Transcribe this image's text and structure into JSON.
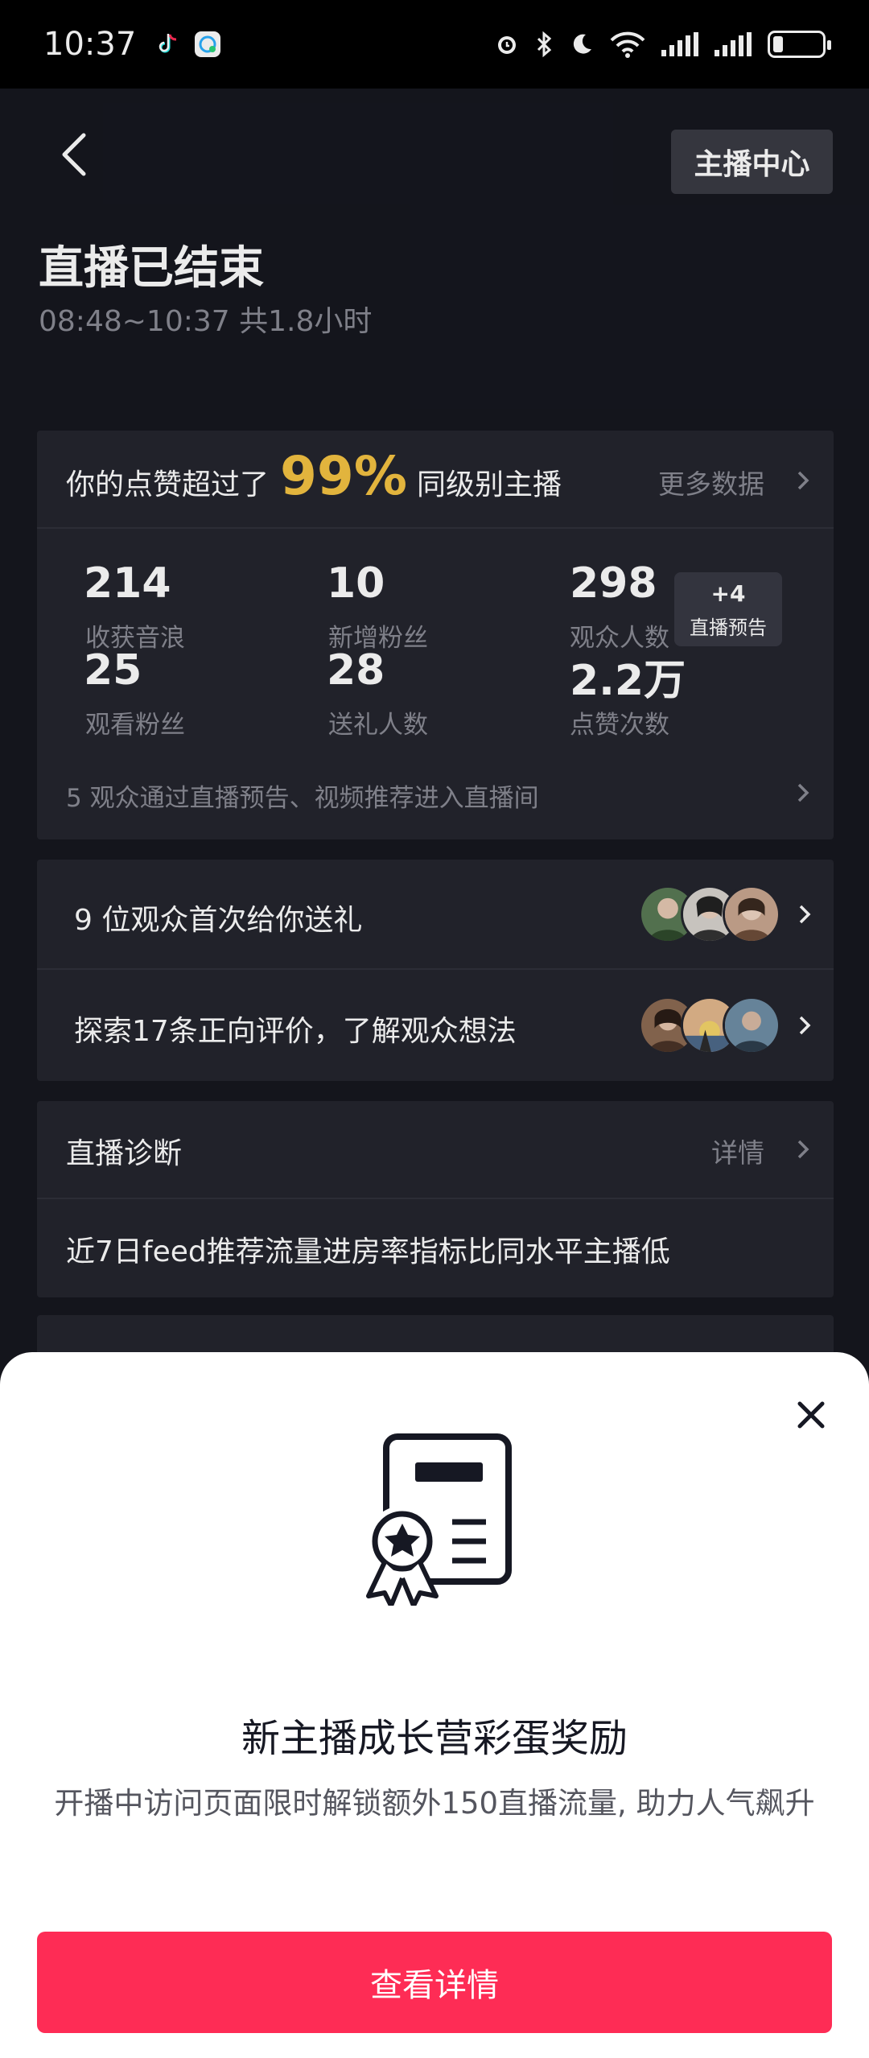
{
  "status_bar": {
    "time": "10:37",
    "app_icons": [
      "tiktok-icon",
      "message-app-icon"
    ],
    "system_icons": [
      "alarm-icon",
      "bluetooth-icon",
      "moon-icon",
      "wifi-icon",
      "signal-icon",
      "signal-icon",
      "battery-icon"
    ],
    "battery_level": 0.2
  },
  "header": {
    "back_icon": "chevron-left-icon",
    "center_button": "主播中心"
  },
  "live_summary": {
    "title": "直播已结束",
    "subtitle": "08:48~10:37 共1.8小时"
  },
  "stats": {
    "headline_prefix": "你的点赞超过了",
    "headline_percent": "99%",
    "headline_suffix": "同级别主播",
    "more_data": "更多数据",
    "items": [
      {
        "value": "214",
        "label": "收获音浪"
      },
      {
        "value": "10",
        "label": "新增粉丝"
      },
      {
        "value": "298",
        "label": "观众人数"
      },
      {
        "value": "25",
        "label": "观看粉丝"
      },
      {
        "value": "28",
        "label": "送礼人数"
      },
      {
        "value": "2.2万",
        "label": "点赞次数"
      }
    ],
    "preview_badge": {
      "count": "+4",
      "label": "直播预告"
    },
    "footer": "5 观众通过直播预告、视频推荐进入直播间",
    "highlight_color": "#f6c443"
  },
  "engagement": {
    "gift_row": "9 位观众首次给你送礼",
    "review_row": "探索17条正向评价，了解观众想法"
  },
  "diagnosis": {
    "title": "直播诊断",
    "more": "详情",
    "body": "近7日feed推荐流量进房率指标比同水平主播低"
  },
  "sheet": {
    "close_icon": "close-icon",
    "icon": "certificate-badge-icon",
    "title": "新主播成长营彩蛋奖励",
    "description": "开播中访问页面限时解锁额外150直播流量, 助力人气飙升",
    "cta": "查看详情",
    "cta_color": "#fe2c55"
  }
}
